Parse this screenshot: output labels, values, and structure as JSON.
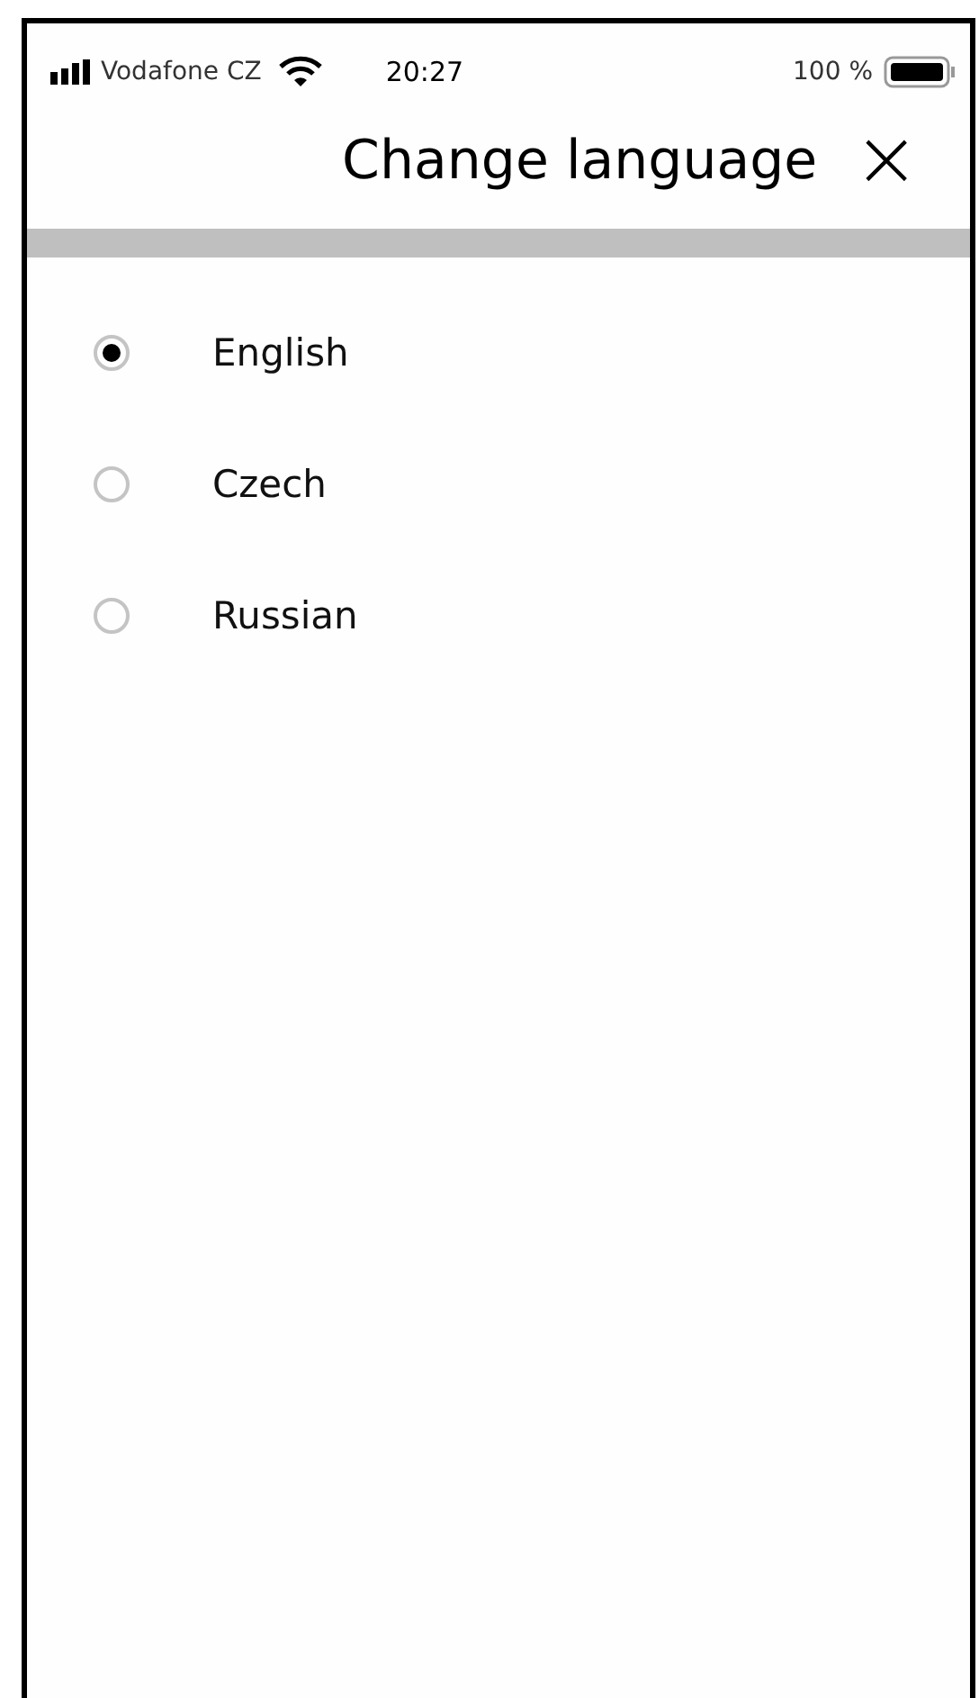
{
  "status_bar": {
    "carrier": "Vodafone CZ",
    "time": "20:27",
    "battery": "100 %"
  },
  "header": {
    "title": "Change language",
    "close": "×"
  },
  "languages": [
    {
      "label": "English",
      "selected": true
    },
    {
      "label": "Czech",
      "selected": false
    },
    {
      "label": "Russian",
      "selected": false
    }
  ]
}
